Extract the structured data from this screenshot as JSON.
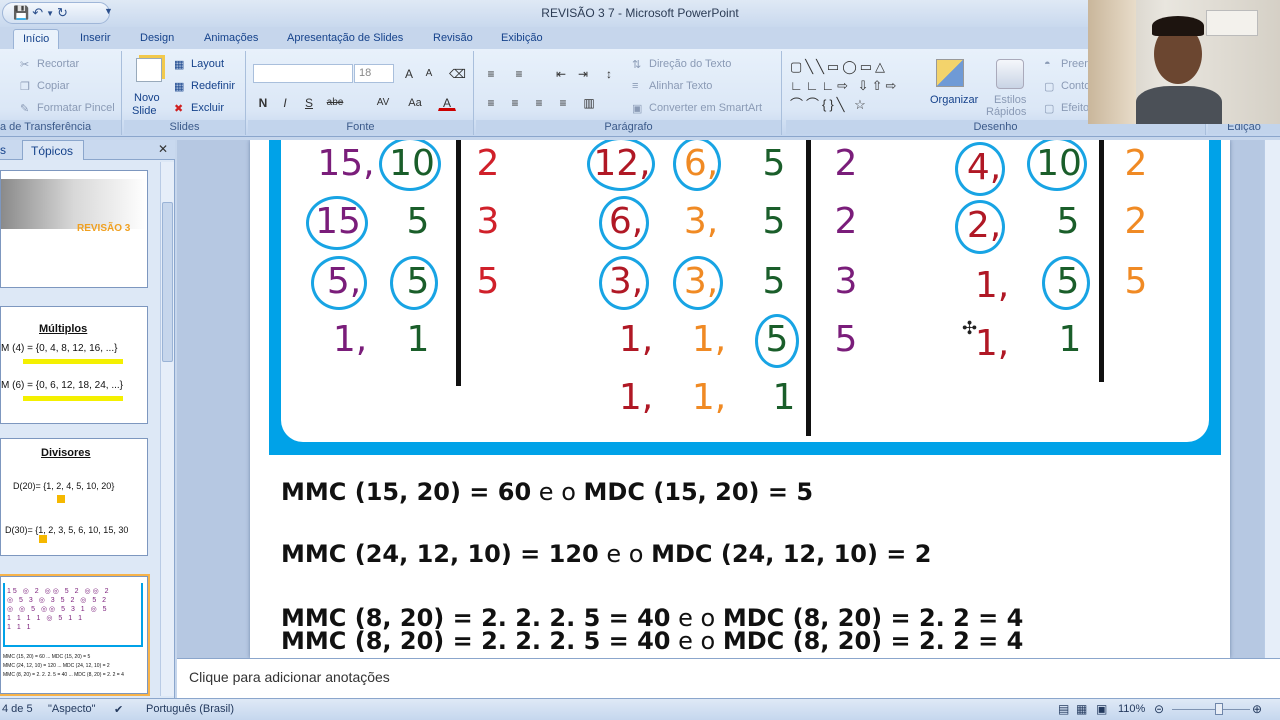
{
  "app": {
    "title": "REVISÃO 3 7 - Microsoft PowerPoint"
  },
  "tabs": [
    "Início",
    "Inserir",
    "Design",
    "Animações",
    "Apresentação de Slides",
    "Revisão",
    "Exibição"
  ],
  "ribbon": {
    "clipboard": {
      "cut": "Recortar",
      "copy": "Copiar",
      "format_painter": "Formatar Pincel",
      "label": "a de Transferência"
    },
    "slides": {
      "new_slide": "Novo",
      "new_slide2": "Slide",
      "layout": "Layout",
      "reset": "Redefinir",
      "delete": "Excluir",
      "label": "Slides"
    },
    "font": {
      "size": "18",
      "label": "Fonte",
      "bold": "N",
      "italic": "I",
      "underline": "S",
      "strike": "abe",
      "spacing": "AV",
      "case": "Aa",
      "color": "A"
    },
    "paragraph": {
      "text_direction": "Direção do Texto",
      "align_text": "Alinhar Texto",
      "smartart": "Converter em SmartArt",
      "label": "Parágrafo"
    },
    "drawing": {
      "arrange": "Organizar",
      "quick_styles": "Estilos",
      "quick_styles2": "Rápidos",
      "fill": "Preen",
      "outline": "Conto",
      "effects": "Efeito",
      "label": "Desenho"
    },
    "editing": {
      "label": "Edição"
    }
  },
  "left_pane": {
    "tab_slides": "s",
    "tab_outline": "Tópicos",
    "thumbs": [
      {
        "title": "REVISÃO 3"
      },
      {
        "title": "Múltiplos",
        "lines": [
          "M (4) = {0, 4, 8, 12, 16, ...}",
          "M (6) = {0, 6, 12, 18, 24, ...}"
        ]
      },
      {
        "title": "Divisores",
        "lines": [
          "D(20)=  {1, 2, 4, 5, 10, 20}",
          "D(30)= {1, 2, 3, 5, 6, 10, 15, 30"
        ]
      },
      {
        "title": ""
      }
    ]
  },
  "slide": {
    "col1_numbers": [
      "15,",
      "10",
      "15",
      "5",
      "5,",
      "5",
      "1,",
      "1"
    ],
    "col1_divisors": [
      "2",
      "3",
      "5"
    ],
    "col2_numbers": [
      "12,",
      "6,",
      "5",
      "6,",
      "3,",
      "5",
      "3,",
      "3,",
      "5",
      "1,",
      "1,",
      "5",
      "1,",
      "1,",
      "1"
    ],
    "col2_divisors": [
      "2",
      "2",
      "3",
      "5"
    ],
    "col3_numbers": [
      "4,",
      "10",
      "2,",
      "5",
      "1,",
      "5",
      "1,",
      "1"
    ],
    "col3_divisors": [
      "2",
      "2",
      "5"
    ],
    "eq1": {
      "a": "MMC (15, 20) = 60",
      "b": " e o ",
      "c": "MDC (15, 20) = 5"
    },
    "eq2": {
      "a": "MMC (24, 12, 10) = 120",
      "b": " e o ",
      "c": "MDC (24, 12, 10) = 2"
    },
    "eq3": {
      "a": "MMC (8, 20) = 2. 2. 2. 5 = 40",
      "b": " e o ",
      "c": "MDC (8, 20) = 2. 2 = 4"
    }
  },
  "notes": {
    "placeholder": "Clique para adicionar anotações"
  },
  "status": {
    "slide": "4 de 5",
    "theme": "\"Aspecto\"",
    "language": "Português (Brasil)",
    "zoom": "110%"
  }
}
